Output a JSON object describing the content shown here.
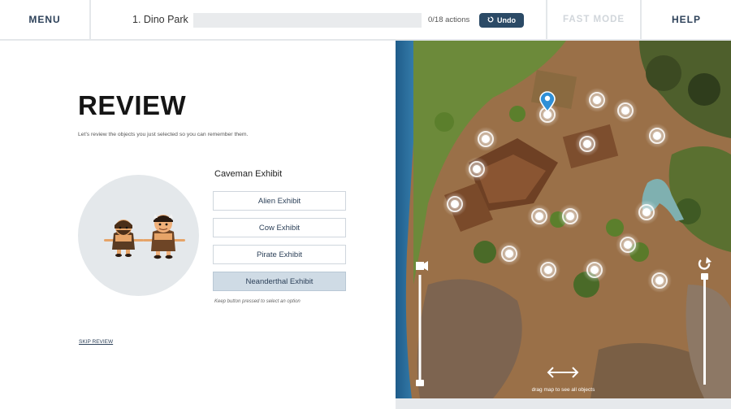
{
  "header": {
    "menu_label": "MENU",
    "level_title": "1. Dino Park",
    "progress_fraction": 0,
    "actions_text": "0/18 actions",
    "undo_label": "Undo",
    "fast_mode_label": "FAST MODE",
    "help_label": "HELP"
  },
  "review": {
    "title": "REVIEW",
    "subtitle": "Let's review the objects you just selected so you can remember them.",
    "question": "Caveman Exhibit",
    "options": [
      {
        "label": "Alien Exhibit",
        "selected": false
      },
      {
        "label": "Cow Exhibit",
        "selected": false
      },
      {
        "label": "Pirate Exhibit",
        "selected": false
      },
      {
        "label": "Neanderthal Exhibit",
        "selected": true
      }
    ],
    "hint": "Keep button pressed to select an option",
    "skip_label": "SKIP REVIEW"
  },
  "map": {
    "drag_hint": "drag map to see all objects",
    "icons": {
      "camera": "camera-icon",
      "rotate": "rotate-icon",
      "drag": "drag-arrows-icon",
      "pin": "map-pin-icon"
    },
    "colors": {
      "marker": "#ffffff",
      "pin": "#2f8fd6",
      "dino": "#7fb0b0"
    }
  }
}
